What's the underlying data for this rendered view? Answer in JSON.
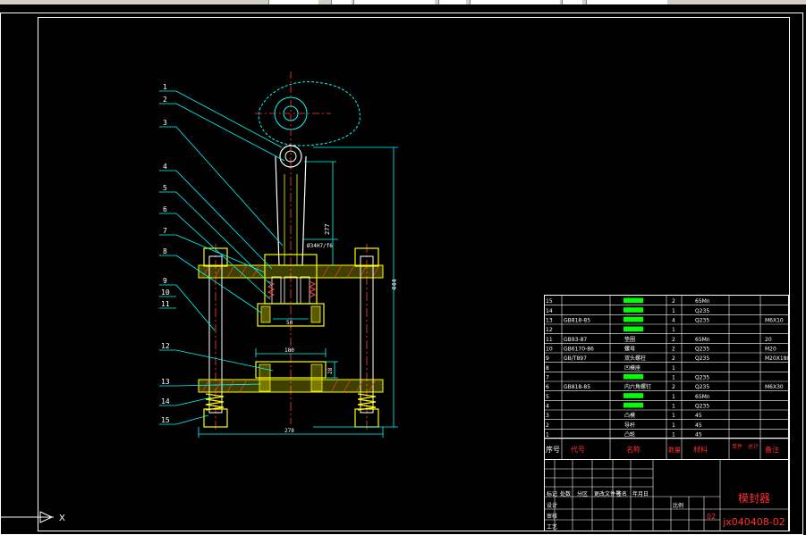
{
  "app": {
    "toolbar_fields": [
      "",
      "",
      "",
      "",
      ""
    ]
  },
  "colors": {
    "background": "#000000",
    "border": "#ffffff",
    "part_yellow": "#ffff00",
    "leader_cyan": "#00ffff",
    "centerline_red": "#ff0000",
    "title_green": "#00ff00",
    "title_red": "#ff3030"
  },
  "drawing": {
    "leader_numbers": [
      "1",
      "2",
      "3",
      "4",
      "5",
      "6",
      "7",
      "8",
      "9",
      "10",
      "11",
      "12",
      "13",
      "14",
      "15"
    ],
    "dims": {
      "overall_height": "444",
      "upper_height": "277",
      "neck_label": "Ø34H7/f6",
      "inner_width": "50",
      "table_width": "180",
      "table_height": "28",
      "base_width": "278"
    }
  },
  "bom": {
    "rows": [
      {
        "no": "15",
        "code": "",
        "name": "",
        "qty": "2",
        "material": "65Mn",
        "note": ""
      },
      {
        "no": "14",
        "code": "",
        "name": "",
        "qty": "1",
        "material": "Q235",
        "note": ""
      },
      {
        "no": "13",
        "code": "GB818-85",
        "name": "",
        "qty": "4",
        "material": "Q235",
        "note": "M6X10"
      },
      {
        "no": "12",
        "code": "",
        "name": "",
        "qty": "1",
        "material": "",
        "note": ""
      },
      {
        "no": "11",
        "code": "GB93-87",
        "name": "垫圈",
        "qty": "2",
        "material": "65Mn",
        "note": "20"
      },
      {
        "no": "10",
        "code": "GB6170-86",
        "name": "螺母",
        "qty": "2",
        "material": "Q235",
        "note": "M20"
      },
      {
        "no": "9",
        "code": "GB/T897",
        "name": "双头螺柱",
        "qty": "2",
        "material": "Q235",
        "note": "M20X180"
      },
      {
        "no": "8",
        "code": "",
        "name": "凹模座",
        "qty": "1",
        "material": "",
        "note": ""
      },
      {
        "no": "7",
        "code": "",
        "name": "",
        "qty": "1",
        "material": "Q235",
        "note": ""
      },
      {
        "no": "6",
        "code": "GB818-85",
        "name": "内六角螺钉",
        "qty": "2",
        "material": "Q235",
        "note": "M6X30"
      },
      {
        "no": "5",
        "code": "",
        "name": "",
        "qty": "1",
        "material": "65Mn",
        "note": ""
      },
      {
        "no": "4",
        "code": "",
        "name": "",
        "qty": "1",
        "material": "Q235",
        "note": ""
      },
      {
        "no": "3",
        "code": "",
        "name": "凸模",
        "qty": "1",
        "material": "45",
        "note": ""
      },
      {
        "no": "2",
        "code": "",
        "name": "导杆",
        "qty": "1",
        "material": "45",
        "note": ""
      },
      {
        "no": "1",
        "code": "",
        "name": "凸轮",
        "qty": "1",
        "material": "45",
        "note": ""
      }
    ],
    "header": {
      "no": "序号",
      "code": "代号",
      "name": "名称",
      "qty": "数量",
      "material": "材料",
      "unit": "单件",
      "total": "总计",
      "note": "备注"
    }
  },
  "title_block": {
    "title": "模封器",
    "drawing_no": "jx040408-02",
    "scale_label": "比例",
    "revision_marks": [
      "标记",
      "处数",
      "分区",
      "更改文件号",
      "签名",
      "年月日"
    ],
    "role_labels": [
      "设计",
      "审核",
      "工艺"
    ],
    "sheet": "02"
  },
  "ucs": {
    "label": "X"
  }
}
